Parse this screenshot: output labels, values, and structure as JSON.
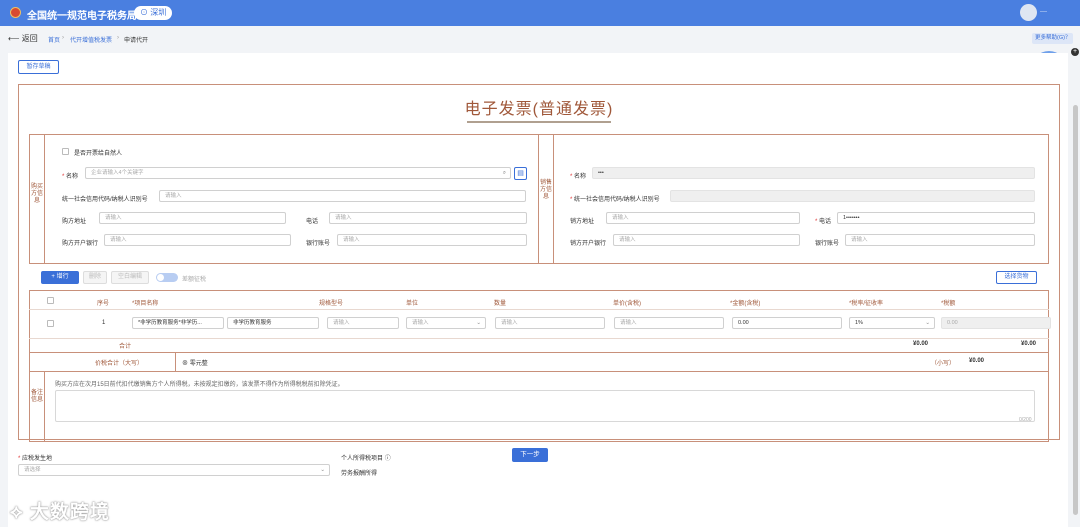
{
  "app": {
    "title": "全国统一规范电子税务局",
    "city": "深圳",
    "user": "—"
  },
  "nav": {
    "back": "返回",
    "crumbs": [
      "首页",
      "代开增值税发票",
      "申请代开"
    ]
  },
  "help": "更多帮助(G)？",
  "buttons": {
    "draft": "暂存草稿",
    "add_row": "+ 增行",
    "delete": "删除",
    "blank_edit": "空白编辑",
    "select_goods": "选择货物",
    "next": "下一步"
  },
  "invoice": {
    "title": "电子发票(普通发票)",
    "buyer": {
      "section": "购买方信息",
      "self_check": "是否开票给自然人",
      "name_label": "名称",
      "name_placeholder": "企业请输入4个关键字",
      "tax_label": "统一社会信用代码/纳税人识别号",
      "addr_label": "购方地址",
      "phone_label": "电话",
      "bank_label": "购方开户银行",
      "account_label": "银行账号",
      "ph": "请输入"
    },
    "seller": {
      "section": "销售方信息",
      "name_label": "名称",
      "name_value": "•••",
      "tax_label": "统一社会信用代码/纳税人识别号",
      "tax_value": "",
      "addr_label": "销方地址",
      "phone_label": "电话",
      "phone_value": "1•••••••",
      "bank_label": "销方开户银行",
      "account_label": "银行账号",
      "ph": "请输入"
    },
    "toggle_label": "差额征税",
    "table": {
      "headers": {
        "no": "序号",
        "item": "*项目名称",
        "spec": "规格型号",
        "unit": "单位",
        "qty": "数量",
        "price": "单价(含税)",
        "amount": "*金额(含税)",
        "rate": "*税率/征收率",
        "tax": "*税额"
      },
      "row": {
        "no": "1",
        "item_code": "*非学历教育服务*非学历...",
        "item_name": "非学历教育服务",
        "ph": "请输入",
        "unit_ph": "请输入",
        "amount": "0.00",
        "rate": "1%",
        "tax": "0.00"
      },
      "subtotal_label": "合计",
      "subtotal_amount": "¥0.00",
      "subtotal_tax": "¥0.00",
      "total_label": "价税合计（大写）",
      "total_cn": "零元整",
      "small_label": "（小写）",
      "small_value": "¥0.00"
    },
    "remarks": {
      "section": "备注信息",
      "text": "购买方应在次月15日前代扣代缴销售方个人所得税，未按规定扣缴的，该发票不得作为所得税税前扣除凭证。",
      "counter": "0/200"
    }
  },
  "extra": {
    "place_label": "应税发生地",
    "place_ph": "请选择",
    "tax_item_label": "个人所得税项目",
    "tax_item_value": "劳务报酬所得"
  },
  "watermark": "大数跨境"
}
